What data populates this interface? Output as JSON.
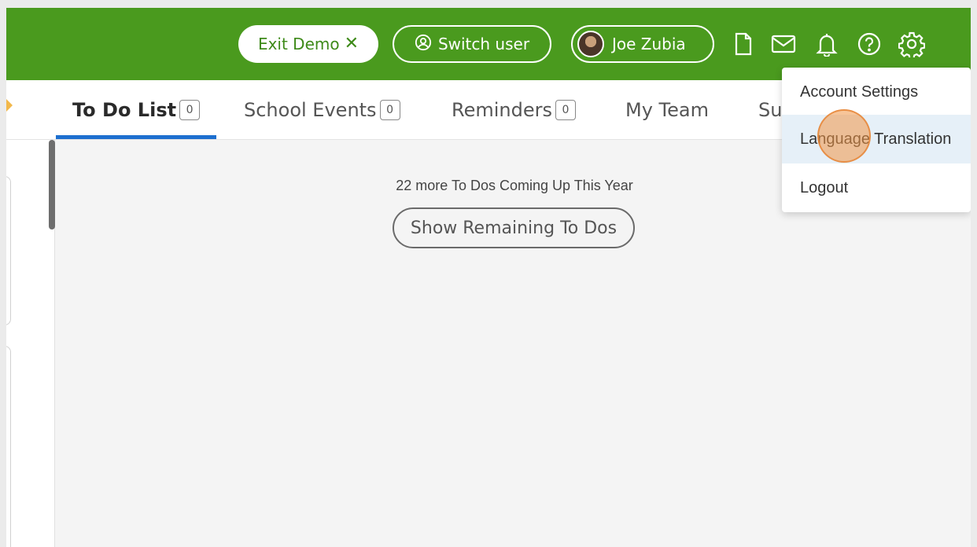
{
  "header": {
    "exit_demo_label": "Exit Demo",
    "exit_demo_icon": "close-icon",
    "switch_user_label": "Switch user",
    "user_name": "Joe Zubia",
    "icons": [
      "document-icon",
      "mail-icon",
      "bell-icon",
      "help-icon",
      "gear-icon"
    ],
    "brand_color": "#4a9a1e"
  },
  "tabs": [
    {
      "label": "To Do List",
      "count": "0"
    },
    {
      "label": "School Events",
      "count": "0"
    },
    {
      "label": "Reminders",
      "count": "0"
    },
    {
      "label": "My Team"
    },
    {
      "label": "Su"
    }
  ],
  "main": {
    "more_text": "22 more To Dos Coming Up This Year",
    "show_remaining_label": "Show Remaining To Dos"
  },
  "dropdown": {
    "items": [
      {
        "label": "Account Settings"
      },
      {
        "label": "Language Translation"
      },
      {
        "label": "Logout"
      }
    ]
  }
}
